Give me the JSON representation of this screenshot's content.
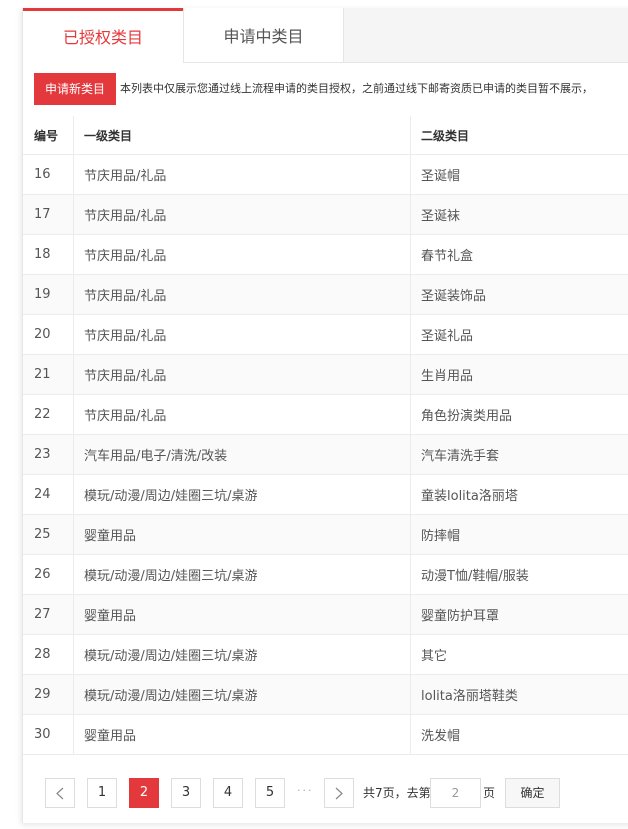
{
  "tabs": [
    {
      "label": "已授权类目",
      "active": true
    },
    {
      "label": "申请中类目",
      "active": false
    }
  ],
  "toolbar": {
    "apply_label": "申请新类目",
    "notice": "本列表中仅展示您通过线上流程申请的类目授权，之前通过线下邮寄资质已申请的类目暂不展示，"
  },
  "table": {
    "headers": [
      "编号",
      "一级类目",
      "二级类目"
    ],
    "rows": [
      [
        "16",
        "节庆用品/礼品",
        "圣诞帽"
      ],
      [
        "17",
        "节庆用品/礼品",
        "圣诞袜"
      ],
      [
        "18",
        "节庆用品/礼品",
        "春节礼盒"
      ],
      [
        "19",
        "节庆用品/礼品",
        "圣诞装饰品"
      ],
      [
        "20",
        "节庆用品/礼品",
        "圣诞礼品"
      ],
      [
        "21",
        "节庆用品/礼品",
        "生肖用品"
      ],
      [
        "22",
        "节庆用品/礼品",
        "角色扮演类用品"
      ],
      [
        "23",
        "汽车用品/电子/清洗/改装",
        "汽车清洗手套"
      ],
      [
        "24",
        "模玩/动漫/周边/娃圈三坑/桌游",
        "童装lolita洛丽塔"
      ],
      [
        "25",
        "婴童用品",
        "防摔帽"
      ],
      [
        "26",
        "模玩/动漫/周边/娃圈三坑/桌游",
        "动漫T恤/鞋帽/服装"
      ],
      [
        "27",
        "婴童用品",
        "婴童防护耳罩"
      ],
      [
        "28",
        "模玩/动漫/周边/娃圈三坑/桌游",
        "其它"
      ],
      [
        "29",
        "模玩/动漫/周边/娃圈三坑/桌游",
        "lolita洛丽塔鞋类"
      ],
      [
        "30",
        "婴童用品",
        "洗发帽"
      ]
    ]
  },
  "pagination": {
    "pages": [
      "1",
      "2",
      "3",
      "4",
      "5"
    ],
    "current": "2",
    "ellipsis": "···",
    "total_text": "共7页，去第",
    "page_suffix": "页",
    "goto_value": "2",
    "confirm_label": "确定"
  },
  "colors": {
    "accent": "#e4393c"
  },
  "icons": {
    "prev": "chevron-left-icon",
    "next": "chevron-right-icon"
  }
}
